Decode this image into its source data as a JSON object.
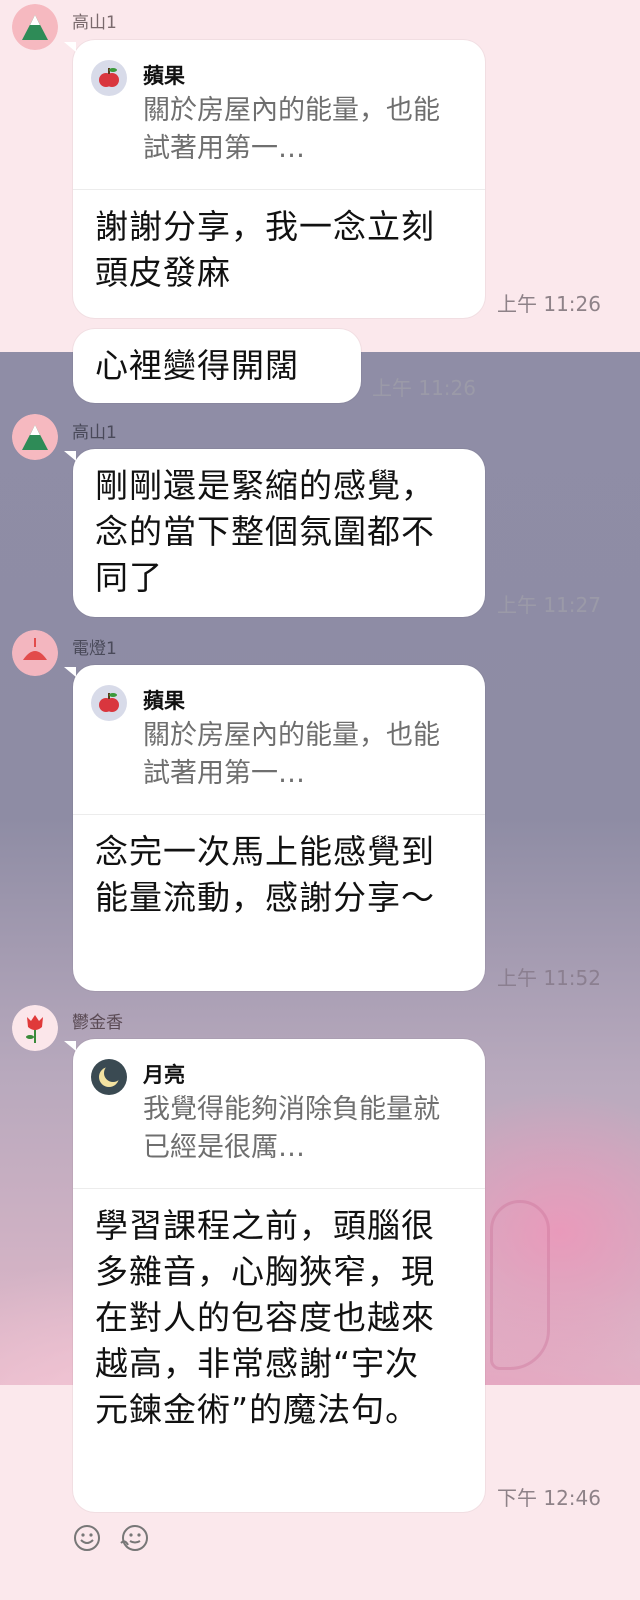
{
  "messages": [
    {
      "sender": "高山1",
      "quote": {
        "name": "蘋果",
        "text": "關於房屋內的能量，也能試著用第一…"
      },
      "text": "謝謝分享，我一念立刻頭皮發麻",
      "time": "上午 11:26"
    },
    {
      "sender": "",
      "quote": null,
      "text": "心裡變得開闊",
      "time": "上午 11:26"
    },
    {
      "sender": "高山1",
      "quote": null,
      "text": "剛剛還是緊縮的感覺，念的當下整個氛圍都不同了",
      "time": "上午 11:27"
    },
    {
      "sender": "電燈1",
      "quote": {
        "name": "蘋果",
        "text": "關於房屋內的能量，也能試著用第一…"
      },
      "text": "念完一次馬上能感覺到能量流動，感謝分享～",
      "time": "上午 11:52"
    },
    {
      "sender": "鬱金香",
      "quote": {
        "name": "月亮",
        "text": "我覺得能夠消除負能量就已經是很厲…"
      },
      "text": "學習課程之前，頭腦很多雜音，心胸狹窄，現在對人的包容度也越來越高，非常感謝“宇次元鍊金術”的魔法句。",
      "time": "下午 12:46"
    }
  ],
  "colors": {
    "bubble": "#ffffff",
    "top_background": "#fbe8ec",
    "wallpaper": "#8f8da6",
    "timestamp": "#8e8288"
  },
  "icons": {
    "mountain_avatar": "mountain-icon",
    "lamp_avatar": "lamp-icon",
    "tulip_avatar": "tulip-icon",
    "apple_quote": "apple-icon",
    "moon_quote": "moon-icon",
    "reaction_smile": "smile-icon",
    "reaction_sticker": "sticker-icon"
  }
}
